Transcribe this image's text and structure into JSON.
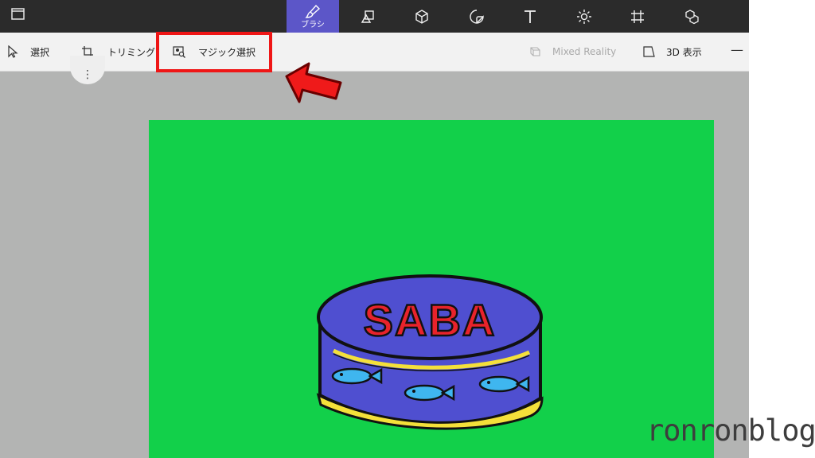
{
  "toolbar": {
    "active_tool_label": "ブラシ",
    "tools": [
      "brush-icon",
      "2d-shapes-icon",
      "3d-shapes-icon",
      "stickers-icon",
      "text-icon",
      "effects-icon",
      "canvas-icon",
      "3d-library-icon"
    ]
  },
  "subbar": {
    "select_label": "選択",
    "crop_label": "トリミング",
    "magic_select_label": "マジック選択",
    "mixed_reality_label": "Mixed Reality",
    "view_3d_label": "3D 表示",
    "minimize_glyph": "—",
    "more_glyph": "⋮"
  },
  "drawing": {
    "can_text": "SABA"
  },
  "watermark": "ronronblog",
  "colors": {
    "accent": "#5c56c8",
    "canvas_bg": "#12d04a",
    "highlight": "#ef1616"
  }
}
